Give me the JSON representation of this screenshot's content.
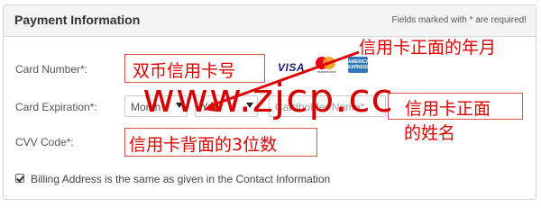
{
  "header": {
    "title": "Payment Information",
    "required_note": "Fields marked with * are required!"
  },
  "fields": {
    "card_number_label": "Card Number*:",
    "card_expiration_label": "Card Expiration*:",
    "month_value": "Month",
    "year_value": "Year",
    "cardholder_placeholder": "Cardholder Name*",
    "cvv_label": "CVV Code*:"
  },
  "card_logos": {
    "visa": "VISA",
    "mastercard_caption": "mastercard",
    "amex": "AMERICAN EXPRESS"
  },
  "billing": {
    "checked": true,
    "label": "Billing Address is the same as given in the Contact Information"
  },
  "annotations": {
    "card_number_note": "双币信用卡号",
    "expiry_note": "信用卡正面的年月",
    "cardholder_note_line1": "信用卡正面",
    "cardholder_note_line2": "的姓名",
    "cvv_note": "信用卡背面的3位数",
    "watermark": "www.zjcp.cc"
  },
  "colors": {
    "annotation_red": "#e10000",
    "header_bg": "#f3f3f3"
  }
}
